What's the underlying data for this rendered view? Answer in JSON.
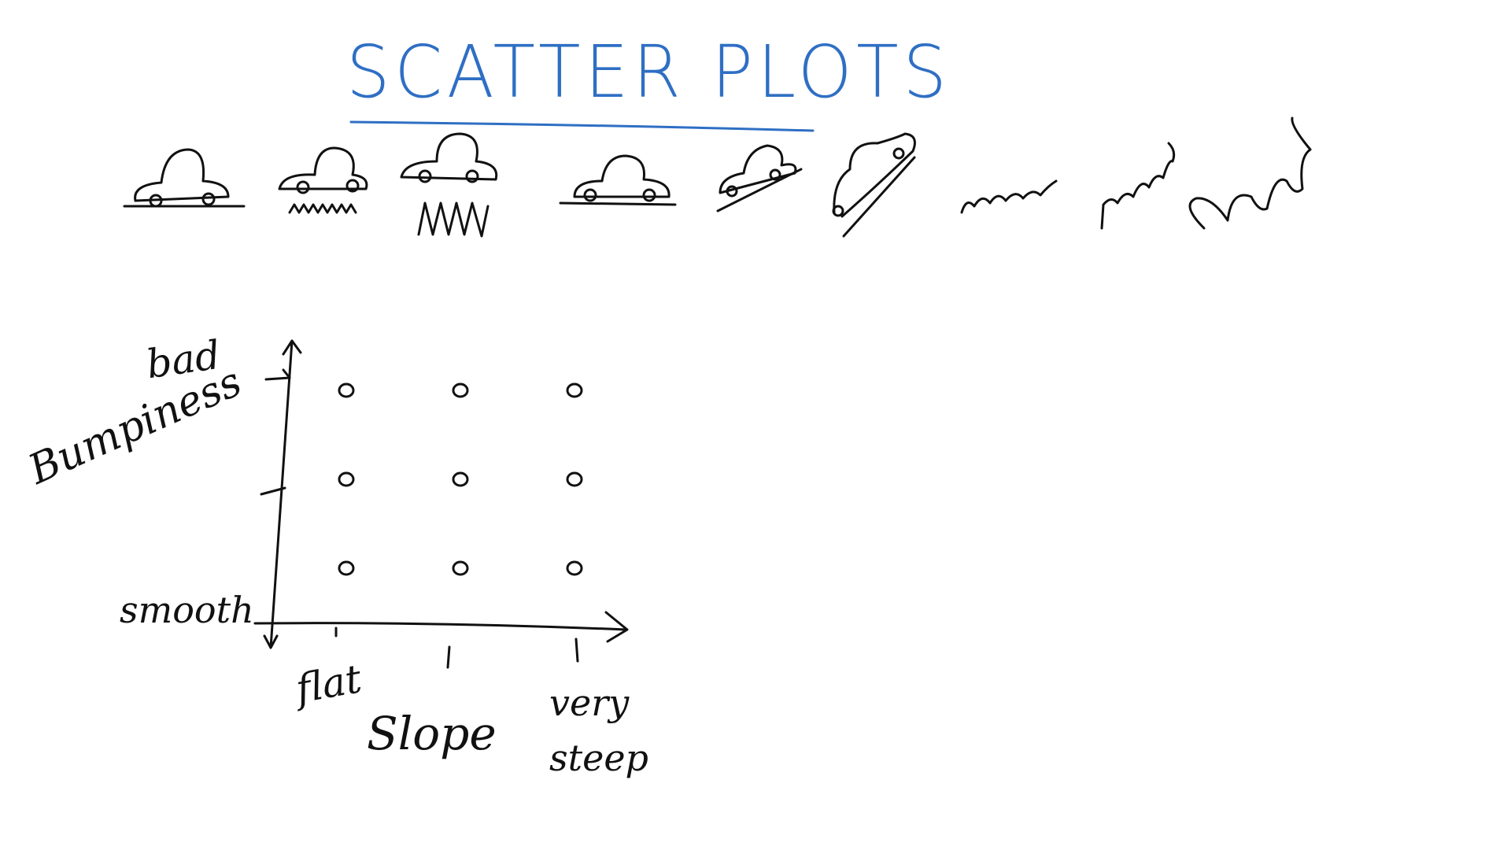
{
  "title": "SCATTER PLOTS",
  "colors": {
    "title": "#2f6fc4",
    "ink": "#111111"
  },
  "icons": [
    "car-flat-smooth-icon",
    "car-flat-bumpy-icon",
    "car-flat-very-bumpy-icon",
    "car-flat-icon",
    "car-slope-icon",
    "car-steep-icon",
    "squiggle-small-icon",
    "squiggle-slope-icon",
    "squiggle-steep-big-icon"
  ],
  "chart_data": {
    "type": "scatter",
    "title": "SCATTER PLOTS",
    "xlabel": "Slope",
    "ylabel": "Bumpiness",
    "xticks": [
      "flat",
      "",
      "very steep"
    ],
    "yticks": [
      "smooth",
      "",
      "bad"
    ],
    "xlim": [
      0,
      3
    ],
    "ylim": [
      0,
      3
    ],
    "points": [
      {
        "x": 1,
        "y": 3
      },
      {
        "x": 2,
        "y": 3
      },
      {
        "x": 3,
        "y": 3
      },
      {
        "x": 1,
        "y": 2
      },
      {
        "x": 2,
        "y": 2
      },
      {
        "x": 3,
        "y": 2
      },
      {
        "x": 1,
        "y": 1
      },
      {
        "x": 2,
        "y": 1
      },
      {
        "x": 3,
        "y": 1
      }
    ]
  }
}
